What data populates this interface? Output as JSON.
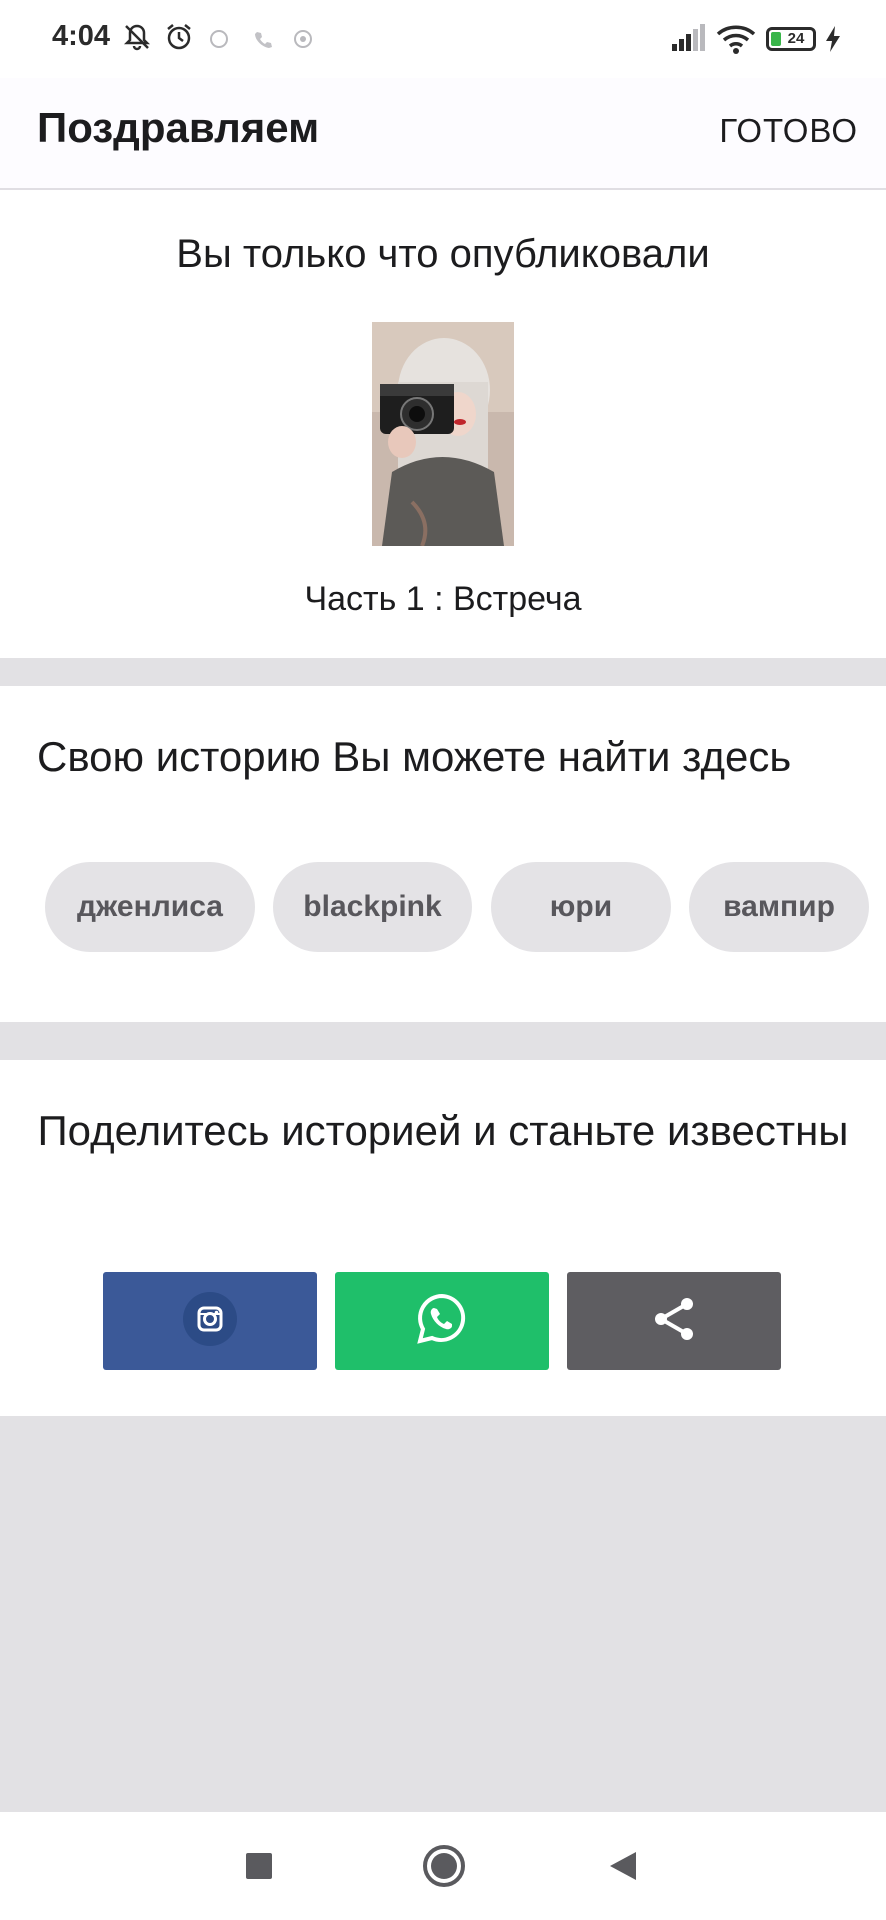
{
  "status_bar": {
    "time": "4:04",
    "battery_level": "24",
    "icons": [
      "notifications-off-icon",
      "alarm-icon",
      "sync-icon",
      "call-icon",
      "vpn-icon",
      "signal-icon",
      "wifi-icon",
      "battery-icon",
      "charging-icon"
    ]
  },
  "app_bar": {
    "title": "Поздравляем",
    "done_label": "ГОТОВО"
  },
  "published": {
    "heading": "Вы только что опубликовали",
    "story_title": "Часть 1 : Встреча"
  },
  "find": {
    "heading": "Свою историю Вы можете найти здесь",
    "tags": [
      "дженлиса",
      "blackpink",
      "юри",
      "вампир"
    ]
  },
  "share": {
    "heading": "Поделитесь историей и станьте известны",
    "buttons": [
      {
        "icon": "instagram-icon",
        "color": "#3b5998"
      },
      {
        "icon": "whatsapp-icon",
        "color": "#1fbf6a"
      },
      {
        "icon": "share-icon",
        "color": "#5e5d61"
      }
    ]
  },
  "nav_bar": {
    "icons": [
      "recents-square-icon",
      "home-circle-icon",
      "back-triangle-icon"
    ]
  },
  "colors": {
    "background": "#e2e1e4",
    "tag_background": "#e4e3e6",
    "tag_text": "#58575c"
  }
}
